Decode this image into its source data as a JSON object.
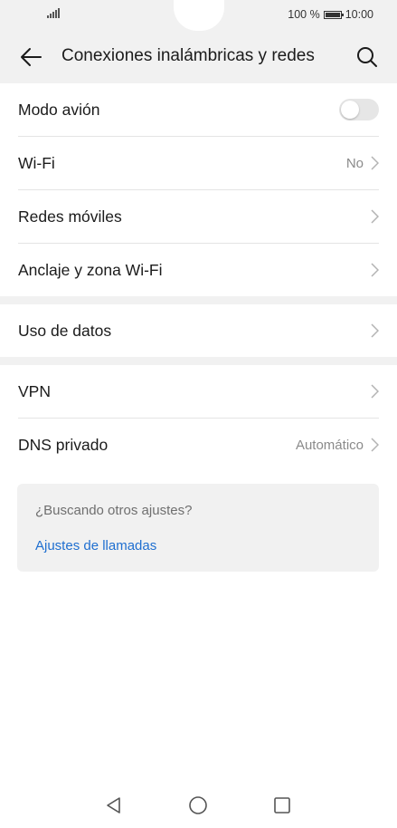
{
  "status_bar": {
    "battery_percent": "100 %",
    "time": "10:00"
  },
  "header": {
    "title": "Conexiones inalámbricas y redes",
    "back_icon": "arrow-left-icon",
    "search_icon": "search-icon"
  },
  "rows": {
    "airplane": {
      "label": "Modo avión",
      "toggle_on": false
    },
    "wifi": {
      "label": "Wi-Fi",
      "value": "No"
    },
    "mobile": {
      "label": "Redes móviles"
    },
    "tethering": {
      "label": "Anclaje y zona Wi-Fi"
    },
    "data_usage": {
      "label": "Uso de datos"
    },
    "vpn": {
      "label": "VPN"
    },
    "dns": {
      "label": "DNS privado",
      "value": "Automático"
    }
  },
  "suggestion_card": {
    "title": "¿Buscando otros ajustes?",
    "link": "Ajustes de llamadas"
  },
  "nav_bar": {
    "back_icon": "triangle-back-icon",
    "home_icon": "circle-home-icon",
    "recents_icon": "square-recents-icon"
  },
  "colors": {
    "background": "#f1f1f1",
    "surface": "#ffffff",
    "link": "#1f6fd0",
    "secondary_text": "#8a8a8a"
  }
}
